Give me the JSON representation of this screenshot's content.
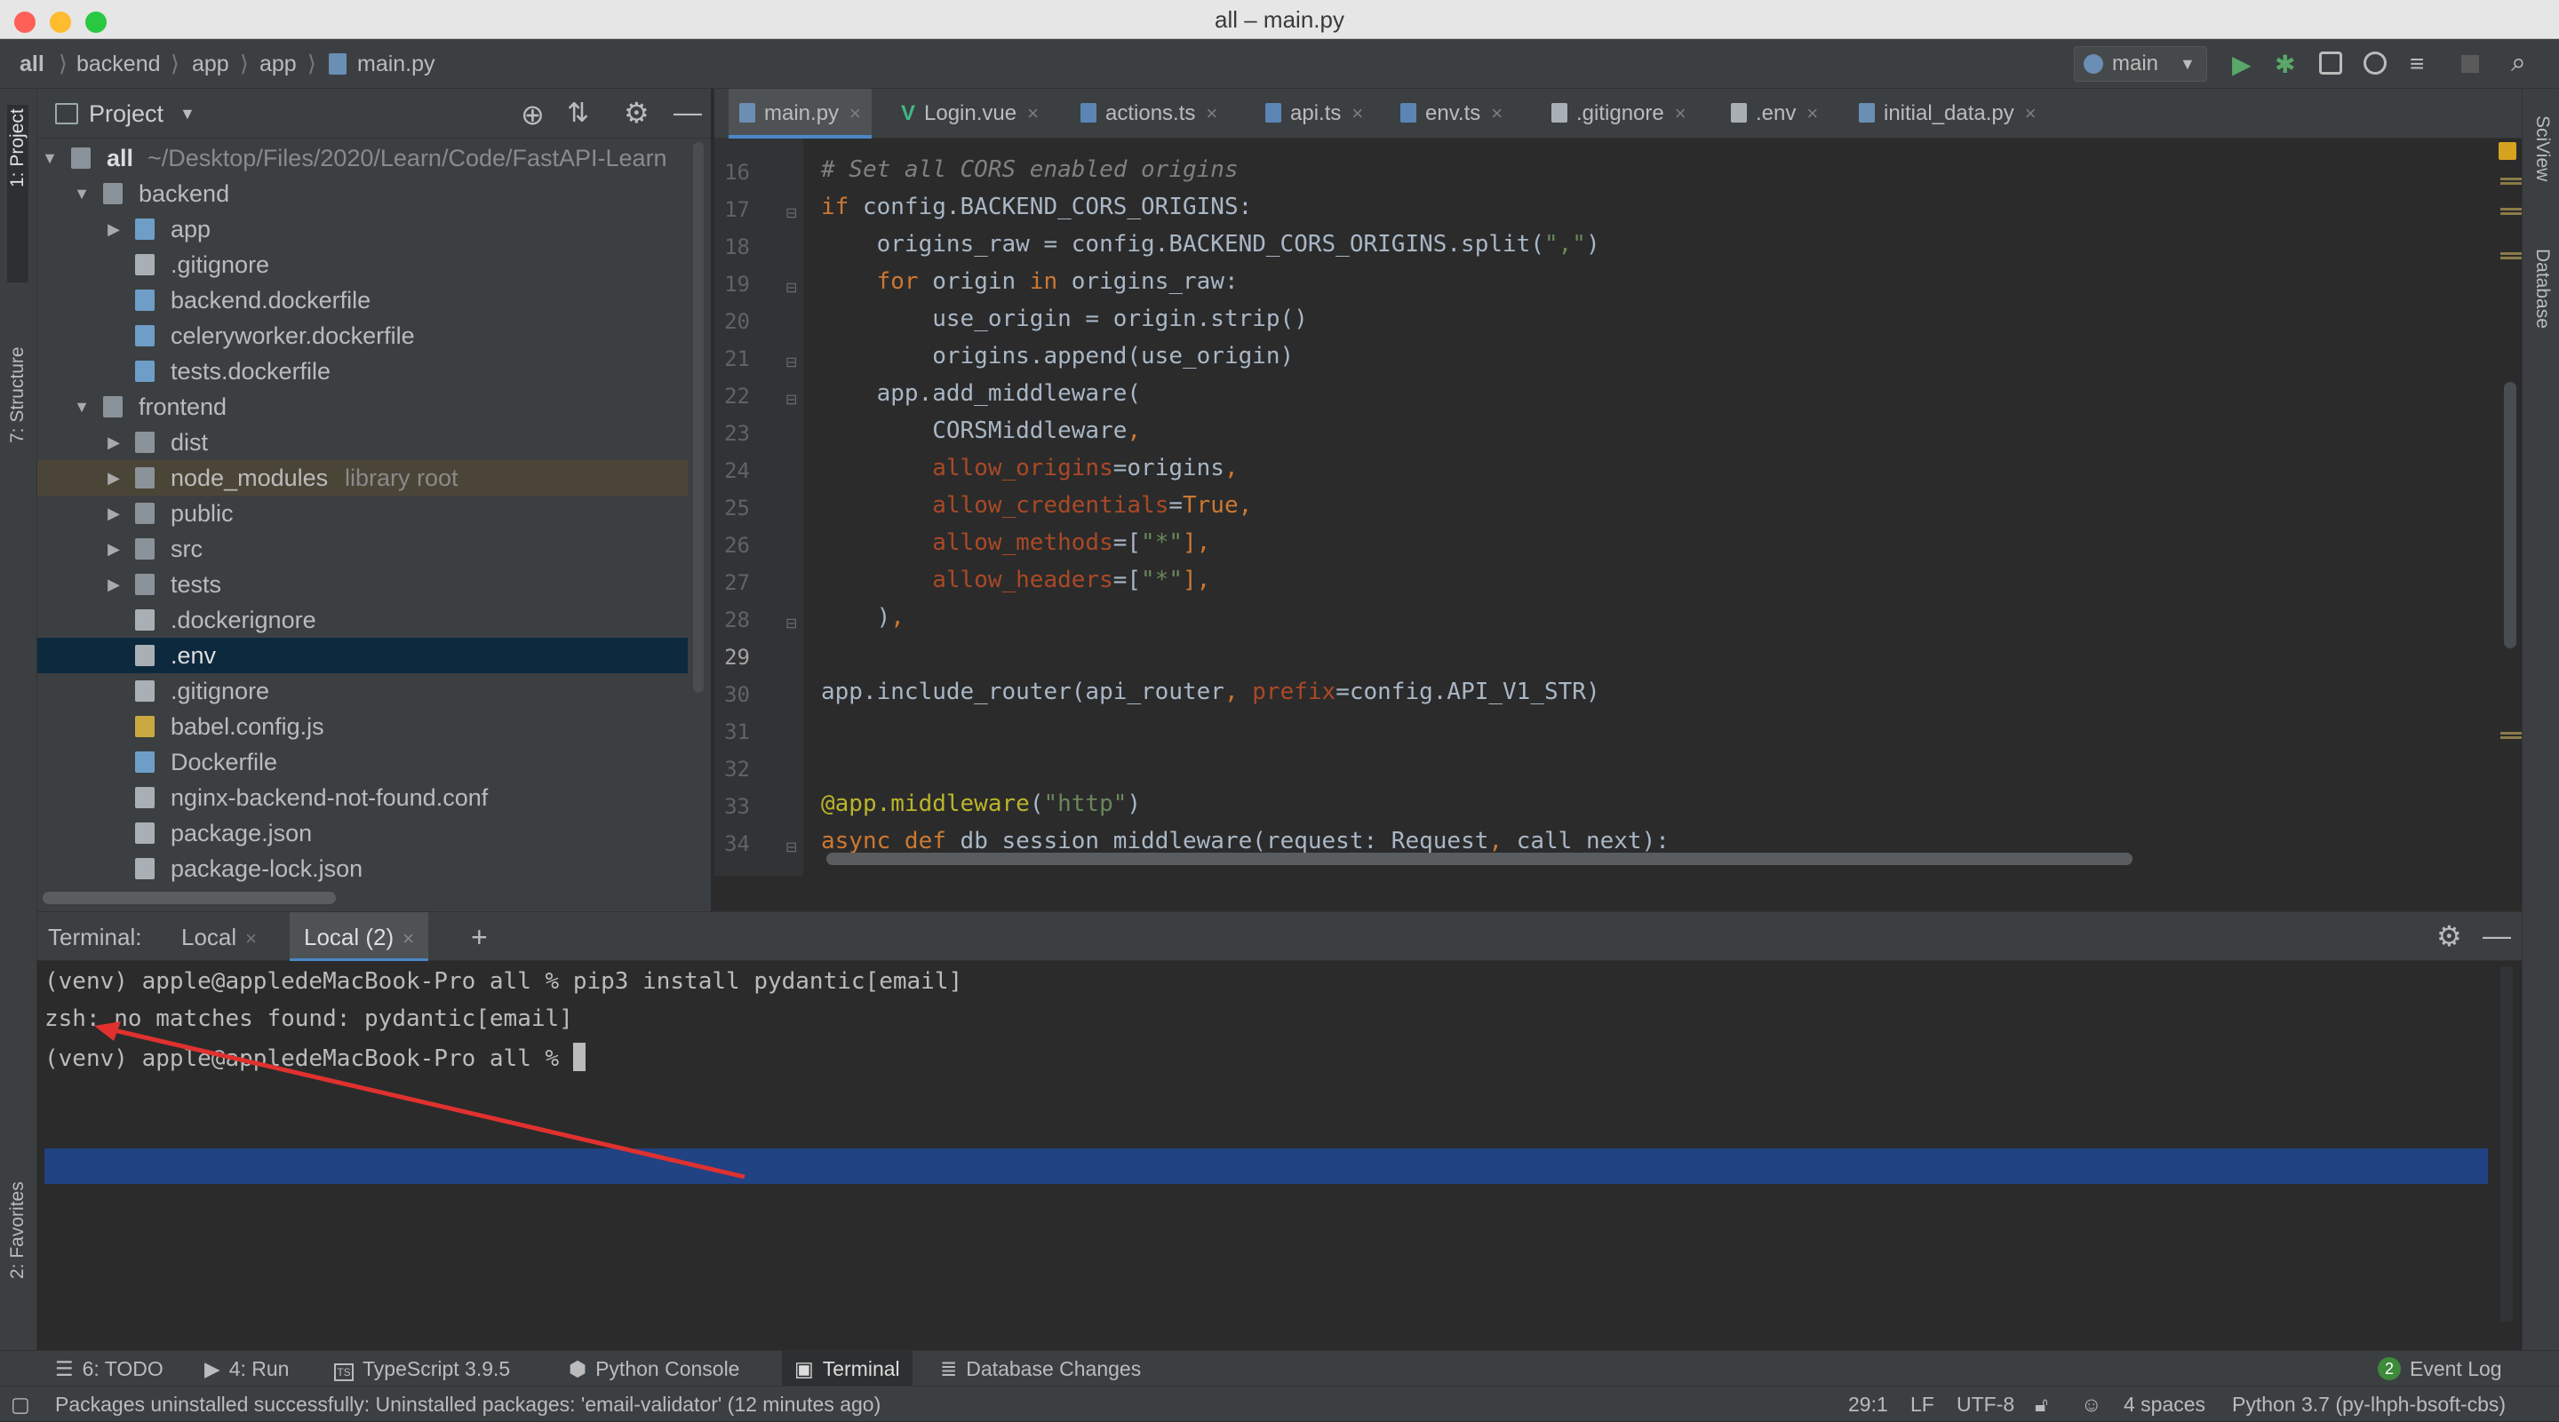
{
  "window": {
    "title": "all – main.py"
  },
  "breadcrumb": [
    "all",
    "backend",
    "app",
    "app",
    "main.py"
  ],
  "run": {
    "config": "main"
  },
  "left_strip": {
    "project": "1: Project",
    "structure": "7: Structure",
    "favorites": "2: Favorites"
  },
  "right_strip": {
    "sciview": "SciView",
    "database": "Database"
  },
  "project": {
    "title": "Project",
    "root_name": "all",
    "root_path": "~/Desktop/Files/2020/Learn/Code/FastAPI-Learn",
    "items": [
      {
        "label": "backend",
        "type": "folder",
        "open": true
      },
      {
        "label": "app",
        "type": "folder",
        "open": false
      },
      {
        "label": ".gitignore",
        "type": "file"
      },
      {
        "label": "backend.dockerfile",
        "type": "file"
      },
      {
        "label": "celeryworker.dockerfile",
        "type": "file"
      },
      {
        "label": "tests.dockerfile",
        "type": "file"
      },
      {
        "label": "frontend",
        "type": "folder",
        "open": true
      },
      {
        "label": "dist",
        "type": "folder",
        "open": false
      },
      {
        "label": "node_modules",
        "type": "folder",
        "open": false,
        "hint": "library root"
      },
      {
        "label": "public",
        "type": "folder",
        "open": false
      },
      {
        "label": "src",
        "type": "folder",
        "open": false
      },
      {
        "label": "tests",
        "type": "folder",
        "open": false
      },
      {
        "label": ".dockerignore",
        "type": "file"
      },
      {
        "label": ".env",
        "type": "file",
        "selected": true
      },
      {
        "label": ".gitignore",
        "type": "file"
      },
      {
        "label": "babel.config.js",
        "type": "file"
      },
      {
        "label": "Dockerfile",
        "type": "file"
      },
      {
        "label": "nginx-backend-not-found.conf",
        "type": "file"
      },
      {
        "label": "package.json",
        "type": "file"
      },
      {
        "label": "package-lock.json",
        "type": "file"
      }
    ]
  },
  "editor": {
    "tabs": [
      {
        "label": "main.py",
        "active": true
      },
      {
        "label": "Login.vue"
      },
      {
        "label": "actions.ts"
      },
      {
        "label": "api.ts"
      },
      {
        "label": "env.ts"
      },
      {
        "label": ".gitignore"
      },
      {
        "label": ".env"
      },
      {
        "label": "initial_data.py"
      }
    ],
    "line_numbers": [
      "16",
      "17",
      "18",
      "19",
      "20",
      "21",
      "22",
      "23",
      "24",
      "25",
      "26",
      "27",
      "28",
      "29",
      "30",
      "31",
      "32",
      "33",
      "34"
    ],
    "code": {
      "l16": "# Set all CORS enabled origins",
      "l17a": "if",
      "l17b": " config.BACKEND_CORS_ORIGINS:",
      "l18a": "    origins_raw = config.BACKEND_CORS_ORIGINS.split(",
      "l18b": "\",\"",
      "l18c": ")",
      "l19a": "    ",
      "l19b": "for",
      "l19c": " origin ",
      "l19d": "in",
      "l19e": " origins_raw:",
      "l20": "        use_origin = origin.strip()",
      "l21": "        origins.append(use_origin)",
      "l22": "    app.add_middleware(",
      "l23a": "        CORSMiddleware",
      "l23b": ",",
      "l24a": "        ",
      "l24b": "allow_origins",
      "l24c": "=origins",
      "l24d": ",",
      "l25a": "        ",
      "l25b": "allow_credentials",
      "l25c": "=",
      "l25d": "True",
      "l25e": ",",
      "l26a": "        ",
      "l26b": "allow_methods",
      "l26c": "=[",
      "l26d": "\"*\"",
      "l26e": "],",
      "l27a": "        ",
      "l27b": "allow_headers",
      "l27c": "=[",
      "l27d": "\"*\"",
      "l27e": "],",
      "l28a": "    )",
      "l28b": ",",
      "l30a": "app.include_router(api_router",
      "l30b": ", ",
      "l30c": "prefix",
      "l30d": "=config.API_V1_STR)",
      "l33a": "@app.middleware",
      "l33b": "(",
      "l33c": "\"http\"",
      "l33d": ")",
      "l34a": "async def",
      "l34b": " db_session_middleware(request: Request",
      "l34c": ", ",
      "l34d": "call_next):"
    }
  },
  "terminal": {
    "label": "Terminal:",
    "tabs": [
      {
        "label": "Local"
      },
      {
        "label": "Local (2)",
        "active": true
      }
    ],
    "add": "+",
    "lines": [
      "(venv) apple@appledeMacBook-Pro all % pip3 install pydantic[email]",
      "zsh: no matches found: pydantic[email]",
      "(venv) apple@appledeMacBook-Pro all % "
    ]
  },
  "toolwindows": [
    {
      "label": "6: TODO",
      "icon": "list-icon"
    },
    {
      "label": "4: Run",
      "icon": "play-icon"
    },
    {
      "label": "TypeScript 3.9.5",
      "icon": "typescript-icon"
    },
    {
      "label": "Python Console",
      "icon": "python-icon"
    },
    {
      "label": "Terminal",
      "icon": "terminal-icon",
      "active": true
    },
    {
      "label": "Database Changes",
      "icon": "database-icon"
    }
  ],
  "event_log": {
    "badge": "2",
    "label": "Event Log"
  },
  "status": {
    "message": "Packages uninstalled successfully: Uninstalled packages: 'email-validator' (12 minutes ago)",
    "position": "29:1",
    "line_sep": "LF",
    "encoding": "UTF-8",
    "indent": "4 spaces",
    "interpreter": "Python 3.7 (py-lhph-bsoft-cbs)"
  },
  "colors": {
    "accent": "#4a88c7",
    "selection": "#0d293e",
    "highlight": "#214283",
    "annotation": "#e0312f"
  }
}
